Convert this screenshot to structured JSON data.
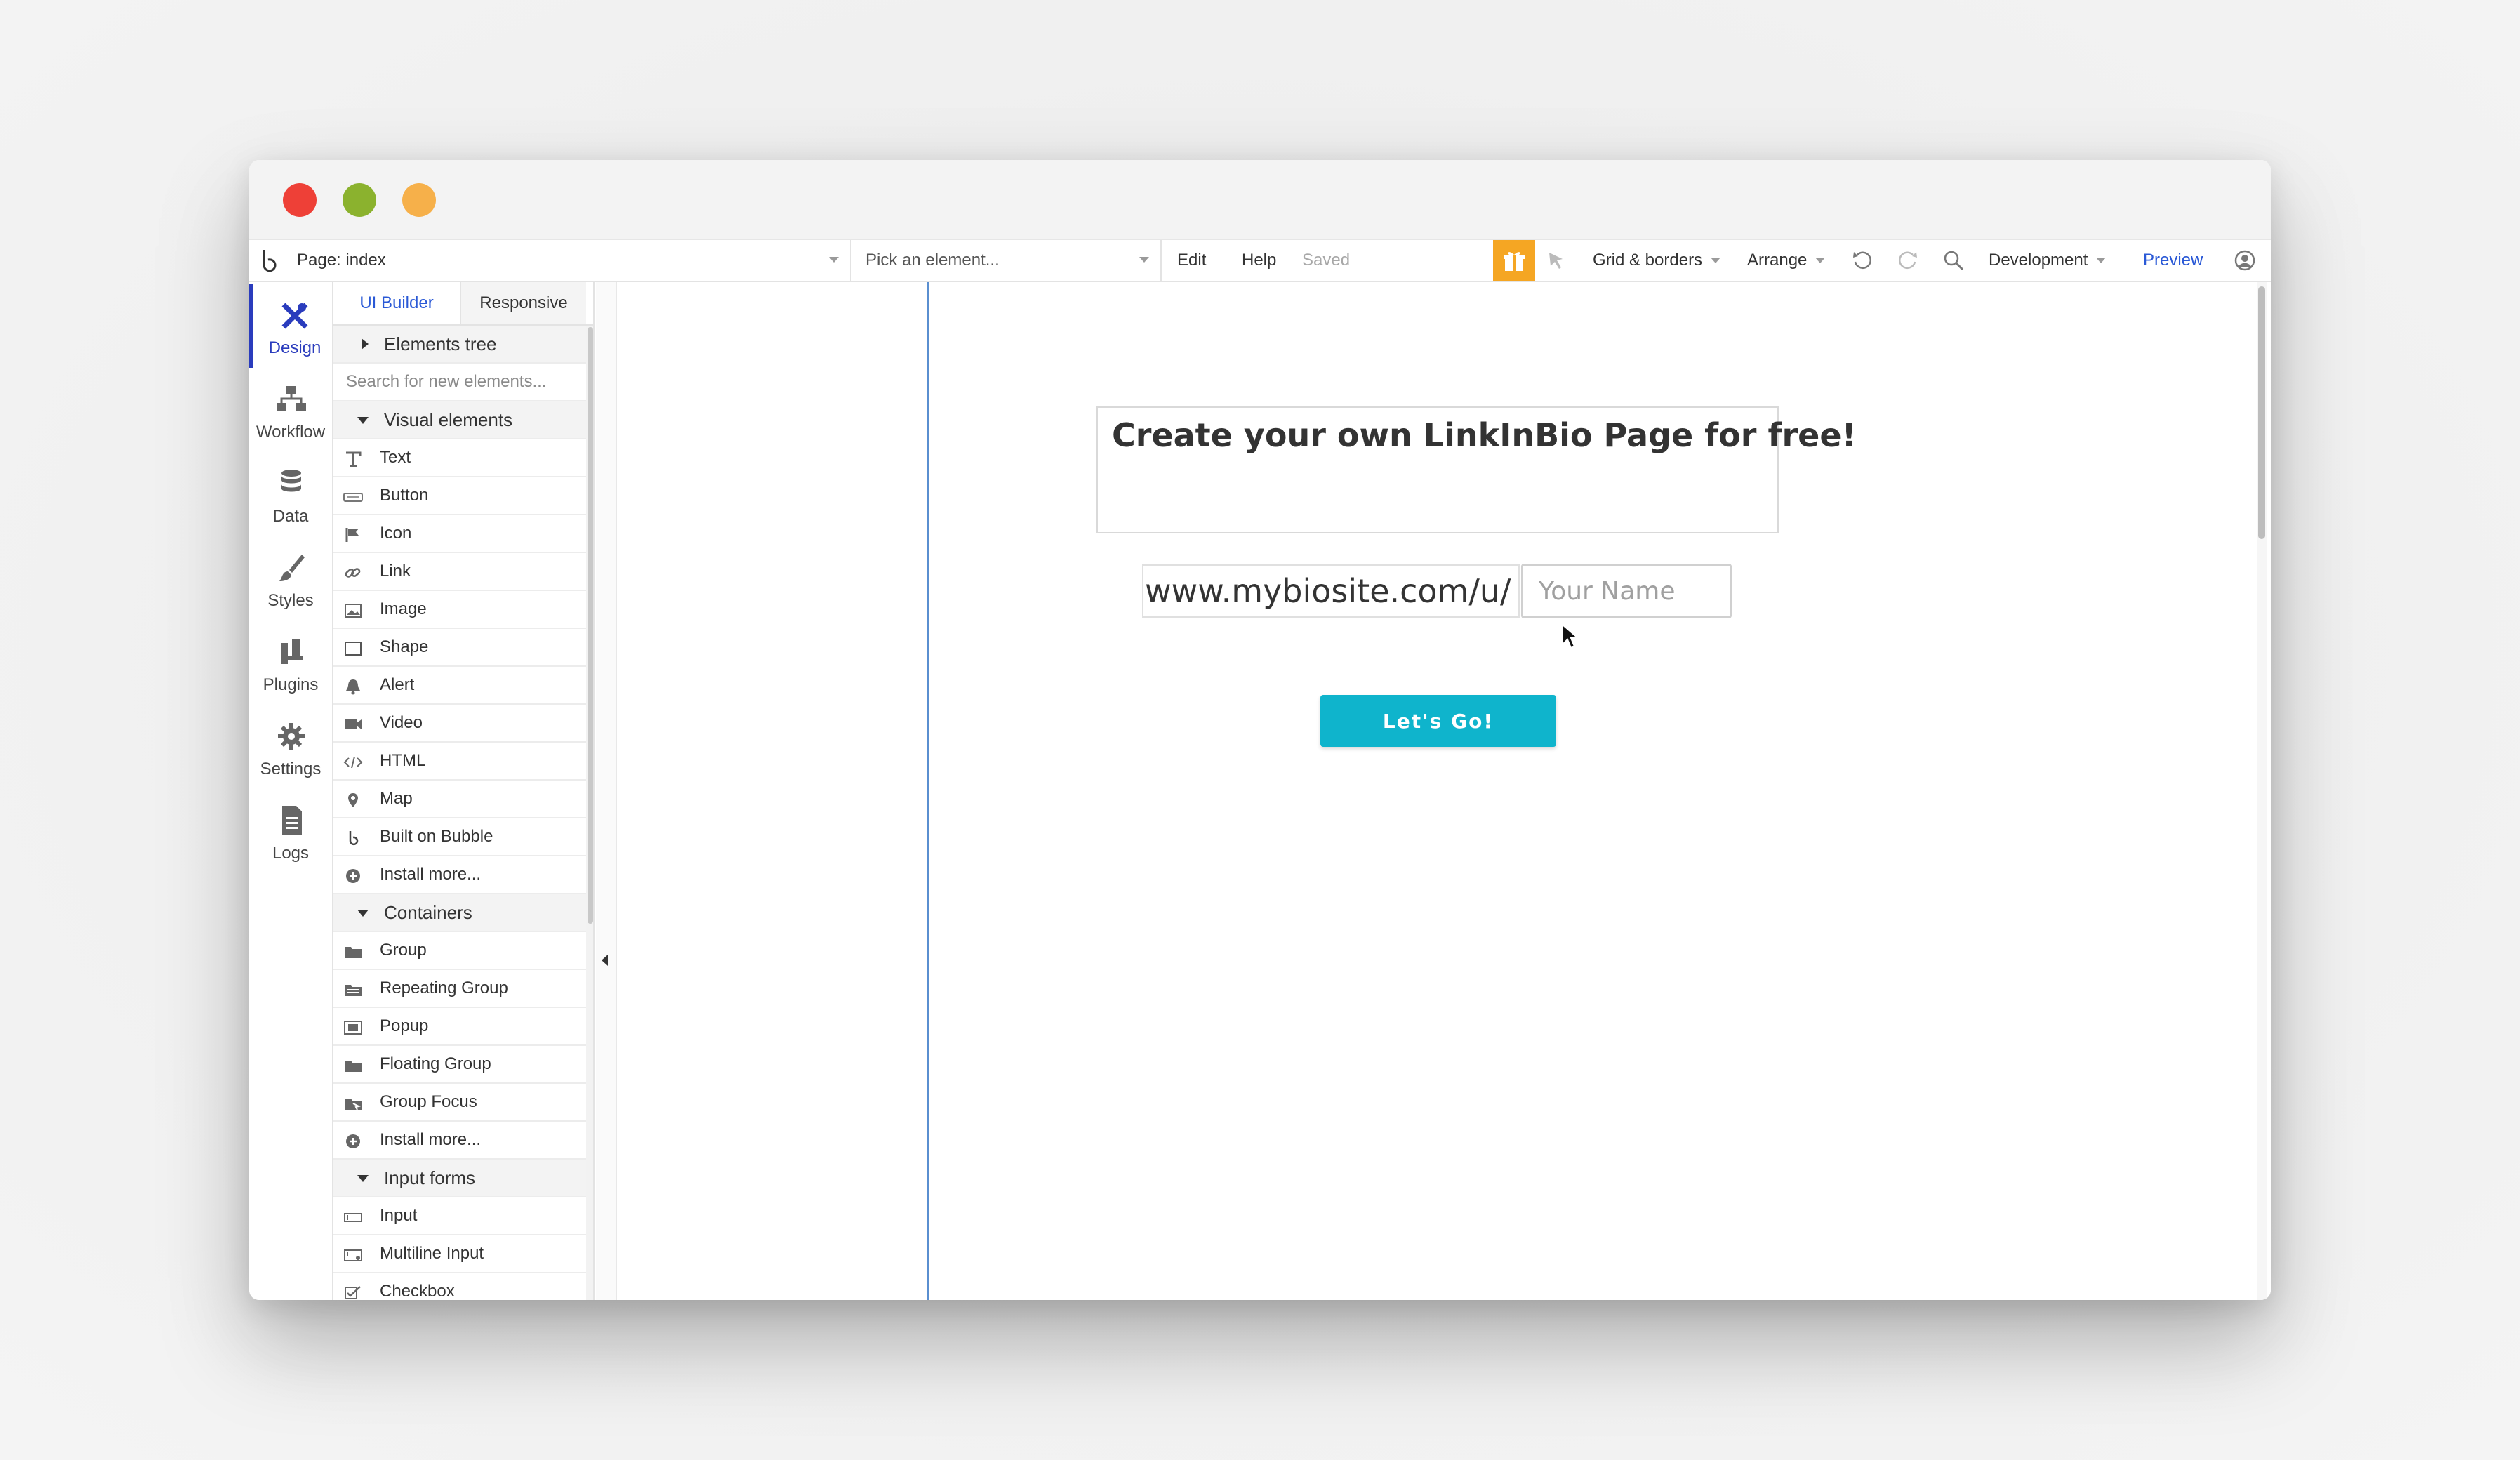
{
  "toolbar": {
    "page_label": "Page: index",
    "pick_element": "Pick an element...",
    "edit": "Edit",
    "help": "Help",
    "saved": "Saved",
    "grid_borders": "Grid & borders",
    "arrange": "Arrange",
    "environment": "Development",
    "preview": "Preview"
  },
  "nav": [
    {
      "label": "Design",
      "icon": "design-icon",
      "active": true
    },
    {
      "label": "Workflow",
      "icon": "workflow-icon"
    },
    {
      "label": "Data",
      "icon": "database-icon"
    },
    {
      "label": "Styles",
      "icon": "brush-icon"
    },
    {
      "label": "Plugins",
      "icon": "plugin-icon"
    },
    {
      "label": "Settings",
      "icon": "gear-icon"
    },
    {
      "label": "Logs",
      "icon": "document-icon"
    }
  ],
  "palette": {
    "tab_ui": "UI Builder",
    "tab_responsive": "Responsive",
    "elements_tree": "Elements tree",
    "search_placeholder": "Search for new elements...",
    "visual_section": "Visual elements",
    "visual_items": [
      "Text",
      "Button",
      "Icon",
      "Link",
      "Image",
      "Shape",
      "Alert",
      "Video",
      "HTML",
      "Map",
      "Built on Bubble",
      "Install more..."
    ],
    "containers_section": "Containers",
    "container_items": [
      "Group",
      "Repeating Group",
      "Popup",
      "Floating Group",
      "Group Focus",
      "Install more..."
    ],
    "input_section": "Input forms",
    "input_items": [
      "Input",
      "Multiline Input",
      "Checkbox"
    ]
  },
  "canvas": {
    "headline": "Create your own LinkInBio Page for free!",
    "url_prefix": "www.mybiosite.com/u/",
    "name_placeholder": "Your Name",
    "button_label": "Let's Go!"
  },
  "colors": {
    "accent": "#2a3cbd",
    "link_blue": "#2a59d6",
    "button_teal": "#0fb4cc",
    "gift_orange": "#f5a623"
  }
}
